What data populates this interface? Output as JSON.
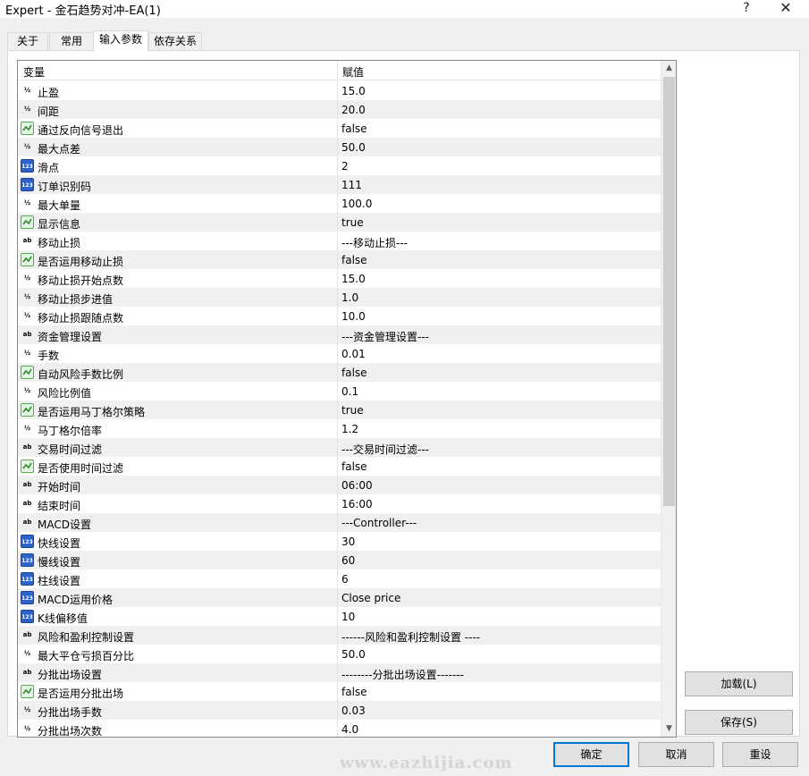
{
  "window": {
    "title": "Expert - 金石趋势对冲-EA(1)",
    "help_label": "?",
    "close_label": "✕"
  },
  "tabs": [
    {
      "label": "关于"
    },
    {
      "label": "常用"
    },
    {
      "label": "输入参数"
    },
    {
      "label": "依存关系"
    }
  ],
  "active_tab": "输入参数",
  "grid": {
    "col_variable": "变量",
    "col_value": "赋值",
    "icon_labels": {
      "double": "½",
      "int": "123",
      "bool": "",
      "string": "ab"
    },
    "rows": [
      {
        "type": "double",
        "name": "止盈",
        "value": "15.0"
      },
      {
        "type": "double",
        "name": "间距",
        "value": "20.0"
      },
      {
        "type": "bool",
        "name": "通过反向信号退出",
        "value": "false"
      },
      {
        "type": "double",
        "name": "最大点差",
        "value": "50.0"
      },
      {
        "type": "int",
        "name": "滑点",
        "value": "2"
      },
      {
        "type": "int",
        "name": "订单识别码",
        "value": "111"
      },
      {
        "type": "double",
        "name": "最大单量",
        "value": "100.0"
      },
      {
        "type": "bool",
        "name": "显示信息",
        "value": "true"
      },
      {
        "type": "string",
        "name": "移动止损",
        "value": "---移动止损---"
      },
      {
        "type": "bool",
        "name": "是否运用移动止损",
        "value": "false"
      },
      {
        "type": "double",
        "name": "移动止损开始点数",
        "value": "15.0"
      },
      {
        "type": "double",
        "name": "移动止损步进值",
        "value": "1.0"
      },
      {
        "type": "double",
        "name": "移动止损跟随点数",
        "value": "10.0"
      },
      {
        "type": "string",
        "name": "资金管理设置",
        "value": "---资金管理设置---"
      },
      {
        "type": "double",
        "name": "手数",
        "value": "0.01"
      },
      {
        "type": "bool",
        "name": "自动风险手数比例",
        "value": "false"
      },
      {
        "type": "double",
        "name": "风险比例值",
        "value": "0.1"
      },
      {
        "type": "bool",
        "name": "是否运用马丁格尔策略",
        "value": "true"
      },
      {
        "type": "double",
        "name": "马丁格尔倍率",
        "value": "1.2"
      },
      {
        "type": "string",
        "name": "交易时间过滤",
        "value": "---交易时间过滤---"
      },
      {
        "type": "bool",
        "name": "是否使用时间过滤",
        "value": "false"
      },
      {
        "type": "string",
        "name": "开始时间",
        "value": "06:00"
      },
      {
        "type": "string",
        "name": "结束时间",
        "value": "16:00"
      },
      {
        "type": "string",
        "name": "MACD设置",
        "value": "---Controller---"
      },
      {
        "type": "int",
        "name": "快线设置",
        "value": "30"
      },
      {
        "type": "int",
        "name": "慢线设置",
        "value": "60"
      },
      {
        "type": "int",
        "name": "柱线设置",
        "value": "6"
      },
      {
        "type": "int",
        "name": "MACD运用价格",
        "value": "Close price"
      },
      {
        "type": "int",
        "name": "K线偏移值",
        "value": "10"
      },
      {
        "type": "string",
        "name": "风险和盈利控制设置",
        "value": "------风险和盈利控制设置 ----"
      },
      {
        "type": "double",
        "name": "最大平仓亏损百分比",
        "value": "50.0"
      },
      {
        "type": "string",
        "name": "分批出场设置",
        "value": "--------分批出场设置-------"
      },
      {
        "type": "bool",
        "name": "是否运用分批出场",
        "value": "false"
      },
      {
        "type": "double",
        "name": "分批出场手数",
        "value": "0.03"
      },
      {
        "type": "double",
        "name": "分批出场次数",
        "value": "4.0"
      }
    ]
  },
  "scrollbar": {
    "up_arrow": "▲",
    "down_arrow": "▼"
  },
  "buttons": {
    "load": "加载(L)",
    "save": "保存(S)",
    "ok": "确定",
    "cancel": "取消",
    "reset": "重设"
  },
  "watermark": "www.eazhijia.com",
  "colors": {
    "accent": "#0078d7",
    "row_alt": "#f0f0f0",
    "grid_border": "#828790"
  }
}
